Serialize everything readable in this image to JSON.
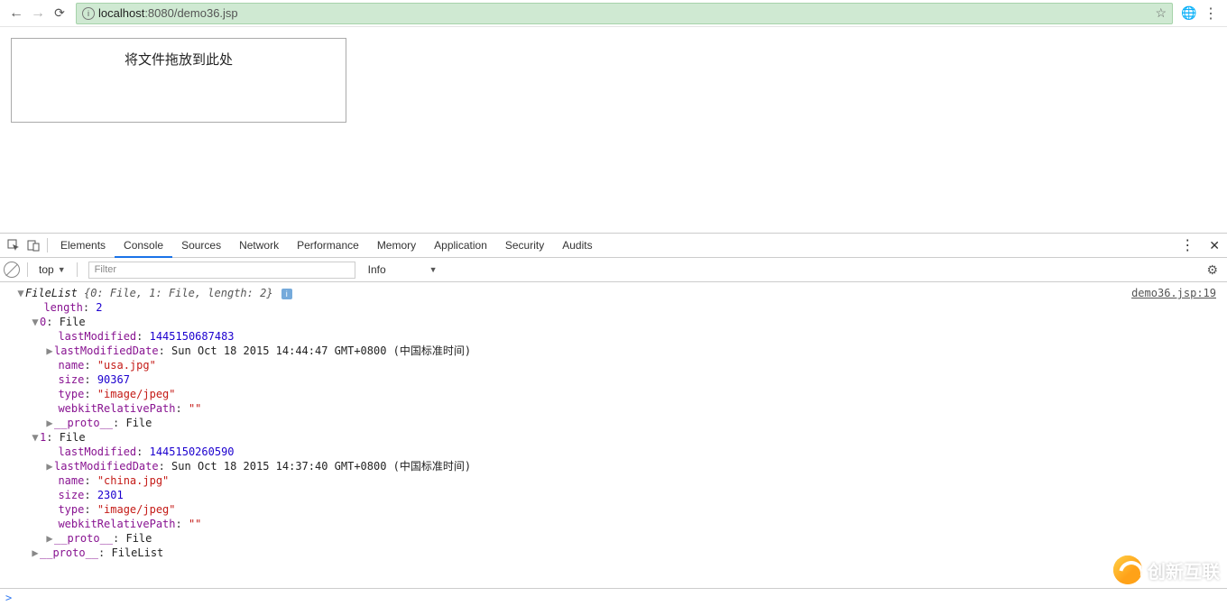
{
  "browser": {
    "url_host": "localhost",
    "url_port_path": ":8080/demo36.jsp"
  },
  "page": {
    "drop_text": "将文件拖放到此处"
  },
  "devtools": {
    "tabs": [
      "Elements",
      "Console",
      "Sources",
      "Network",
      "Performance",
      "Memory",
      "Application",
      "Security",
      "Audits"
    ],
    "active_tab": "Console",
    "context": "top",
    "filter_placeholder": "Filter",
    "info_label": "Info",
    "source_link": "demo36.jsp:19"
  },
  "console": {
    "header_type": "FileList",
    "header_summary": "{0: File, 1: File, length: 2}",
    "length_key": "length",
    "length_val": "2",
    "files": [
      {
        "index": "0",
        "type_label": "File",
        "lastModified_key": "lastModified",
        "lastModified": "1445150687483",
        "lastModifiedDate_key": "lastModifiedDate",
        "lastModifiedDate": "Sun Oct 18 2015 14:44:47 GMT+0800 (中国标准时间)",
        "name_key": "name",
        "name": "\"usa.jpg\"",
        "size_key": "size",
        "size": "90367",
        "type_key": "type",
        "type": "\"image/jpeg\"",
        "webkitRelativePath_key": "webkitRelativePath",
        "webkitRelativePath": "\"\"",
        "proto_key": "__proto__",
        "proto_val": "File"
      },
      {
        "index": "1",
        "type_label": "File",
        "lastModified_key": "lastModified",
        "lastModified": "1445150260590",
        "lastModifiedDate_key": "lastModifiedDate",
        "lastModifiedDate": "Sun Oct 18 2015 14:37:40 GMT+0800 (中国标准时间)",
        "name_key": "name",
        "name": "\"china.jpg\"",
        "size_key": "size",
        "size": "2301",
        "type_key": "type",
        "type": "\"image/jpeg\"",
        "webkitRelativePath_key": "webkitRelativePath",
        "webkitRelativePath": "\"\"",
        "proto_key": "__proto__",
        "proto_val": "File"
      }
    ],
    "outer_proto_key": "__proto__",
    "outer_proto_val": "FileList",
    "prompt": ">"
  },
  "watermark": {
    "text": "创新互联"
  }
}
